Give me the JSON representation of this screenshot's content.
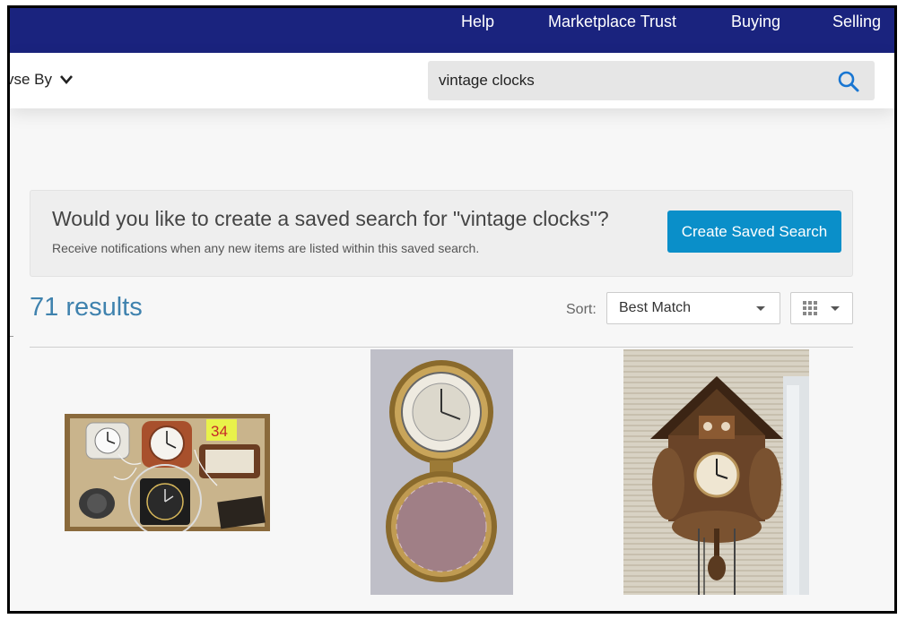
{
  "nav": {
    "links": [
      "Help",
      "Marketplace Trust",
      "Buying",
      "Selling"
    ]
  },
  "header": {
    "browse_label": "vse By",
    "search_value": "vintage clocks",
    "search_icon": "search-icon"
  },
  "banner": {
    "question": "Would you like to create a saved search for \"vintage clocks\"?",
    "subtext": "Receive notifications when any new items are listed within this saved search.",
    "button_label": "Create Saved Search"
  },
  "results": {
    "count_text": "71 results",
    "sort_label": "Sort:",
    "sort_value": "Best Match",
    "view_icon": "grid-view-icon"
  },
  "listings": [
    {
      "image": "lot-of-vintage-alarm-clocks-photo",
      "tag": "34"
    },
    {
      "image": "pocket-travel-clock-photo"
    },
    {
      "image": "cuckoo-clock-photo"
    }
  ]
}
